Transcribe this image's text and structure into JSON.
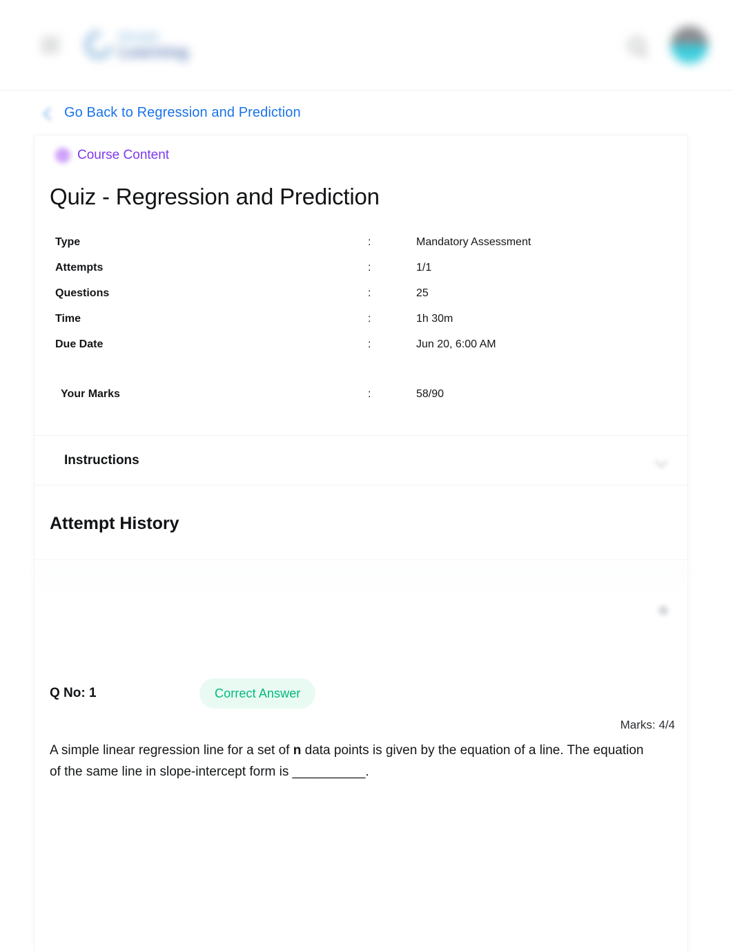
{
  "header": {
    "menu_icon": "hamburger-menu-icon",
    "logo_top_text": "Great",
    "logo_bottom_text": "Learning",
    "search_icon": "search-icon",
    "avatar": "user-avatar"
  },
  "back_link": {
    "icon": "back-arrow-icon",
    "label": "Go Back to Regression and Prediction"
  },
  "breadcrumb": {
    "icon": "course-content-icon",
    "label": "Course Content"
  },
  "quiz": {
    "title": "Quiz - Regression and Prediction",
    "meta": [
      {
        "key": "Type",
        "sep": ":",
        "value": "Mandatory Assessment"
      },
      {
        "key": "Attempts",
        "sep": ":",
        "value": "1/1"
      },
      {
        "key": "Questions",
        "sep": ":",
        "value": "25"
      },
      {
        "key": "Time",
        "sep": ":",
        "value": "1h 30m"
      },
      {
        "key": "Due Date",
        "sep": ":",
        "value": "Jun 20, 6:00 AM"
      }
    ],
    "marks_row": {
      "key": "Your Marks",
      "sep": ":",
      "value": "58/90"
    }
  },
  "instructions": {
    "title": "Instructions",
    "expand_icon": "chevron-down-icon"
  },
  "attempt_history": {
    "title": "Attempt History",
    "overflow_icon": "more-options-icon"
  },
  "question": {
    "number_label": "Q No: 1",
    "status_label": "Correct Answer",
    "status_color": "#00ba7c",
    "status_bg": "#e9faf3",
    "marks_label": "Marks: 4/4",
    "text_part1": "A simple linear regression line for a set of ",
    "text_bold": "n",
    "text_part2": " data points is given by the equation of a line. The equation of the same line in slope-intercept form is __________."
  }
}
